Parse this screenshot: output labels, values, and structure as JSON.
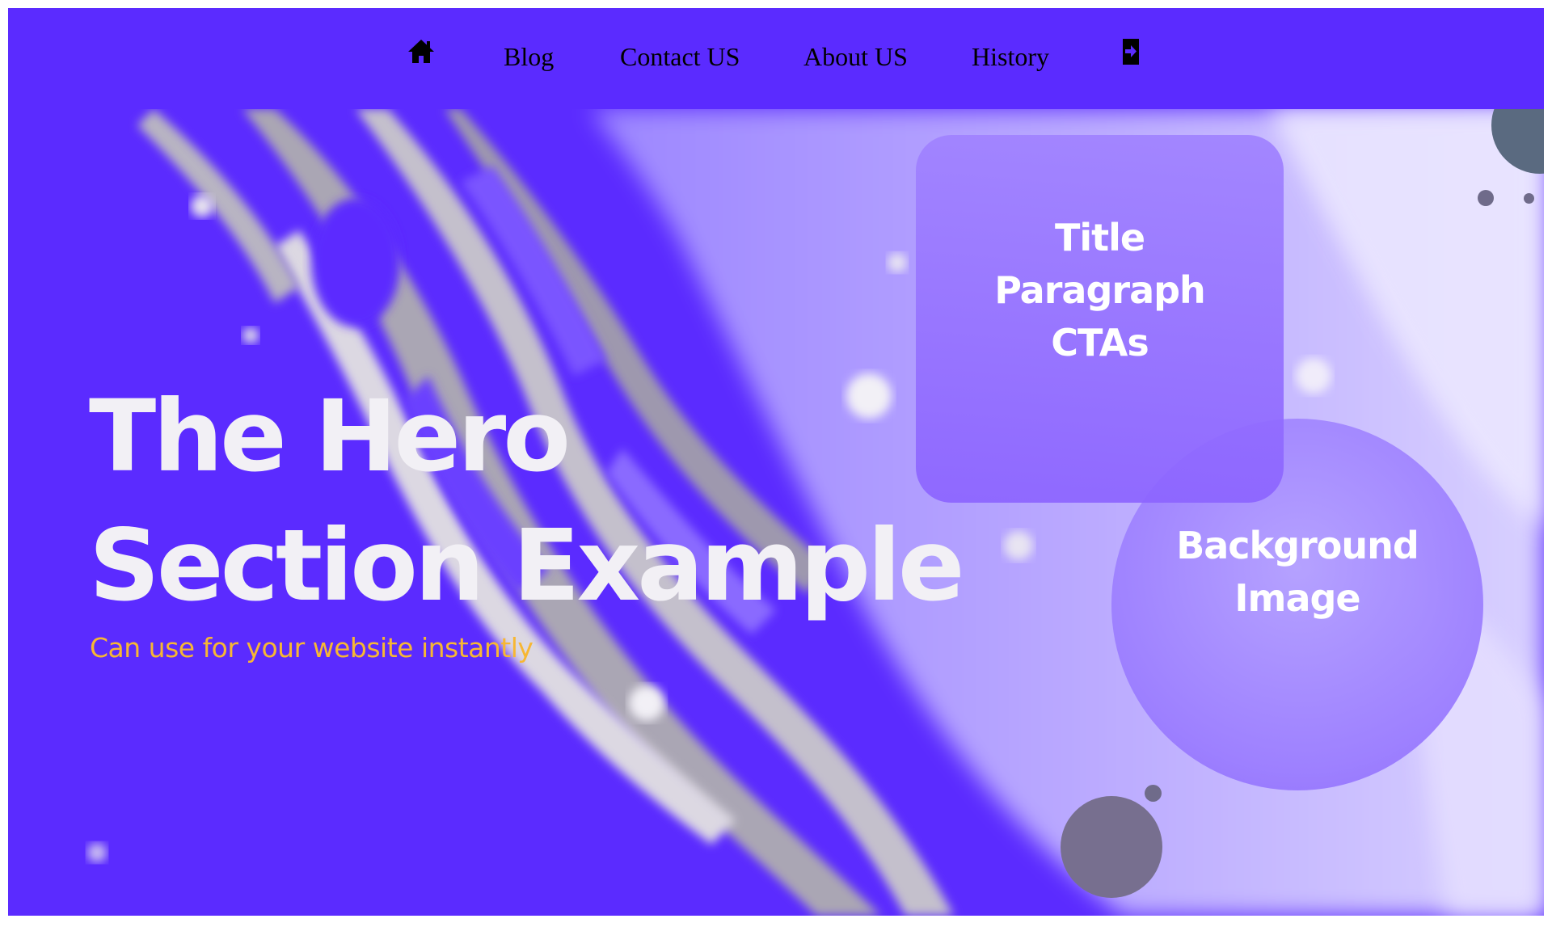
{
  "nav": {
    "home_icon": "home-icon",
    "items": [
      {
        "label": "Blog"
      },
      {
        "label": "Contact US"
      },
      {
        "label": "About US"
      },
      {
        "label": "History"
      }
    ],
    "login_icon": "sign-in-icon"
  },
  "hero": {
    "title_line1": "The Hero",
    "title_line2": "Section Example",
    "subtitle": "Can use for your website instantly",
    "card": {
      "line1": "Title",
      "line2": "Paragraph",
      "line3": "CTAs"
    },
    "circle": {
      "line1": "Background",
      "line2": "Image"
    }
  },
  "colors": {
    "brand": "#5b2bff",
    "subtitle": "#f7b733",
    "hero_text": "#f2f0f5",
    "card": "#9a7cff",
    "circle": "#a68cff",
    "dot": "#6f6b8a"
  }
}
